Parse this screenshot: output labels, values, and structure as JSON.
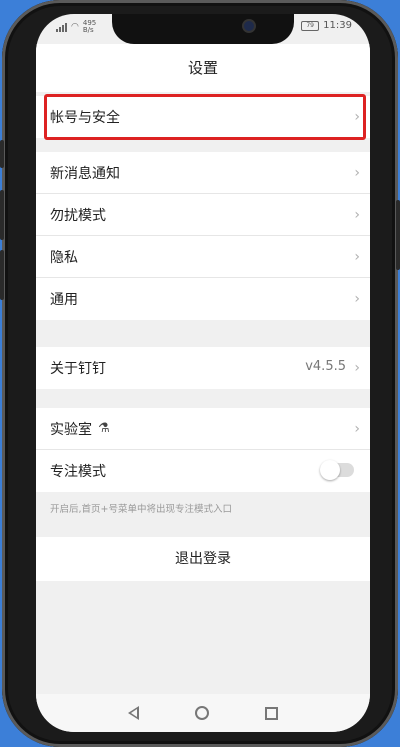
{
  "status": {
    "time": "11:39",
    "network_speed": "495\nB/s",
    "battery": "79"
  },
  "header": {
    "title": "设置"
  },
  "group1": {
    "items": [
      {
        "label": "帐号与安全"
      }
    ]
  },
  "group2": {
    "items": [
      {
        "label": "新消息通知"
      },
      {
        "label": "勿扰模式"
      },
      {
        "label": "隐私"
      },
      {
        "label": "通用"
      }
    ]
  },
  "group3": {
    "items": [
      {
        "label": "关于钉钉",
        "value": "v4.5.5"
      }
    ]
  },
  "group4": {
    "items": [
      {
        "label": "实验室"
      },
      {
        "label": "专注模式",
        "toggle": false
      }
    ]
  },
  "hint": "开启后,首页+号菜单中将出现专注模式入口",
  "logout": {
    "label": "退出登录"
  },
  "icons": {
    "chevron": "chevron-right-icon",
    "flask": "flask-icon"
  }
}
